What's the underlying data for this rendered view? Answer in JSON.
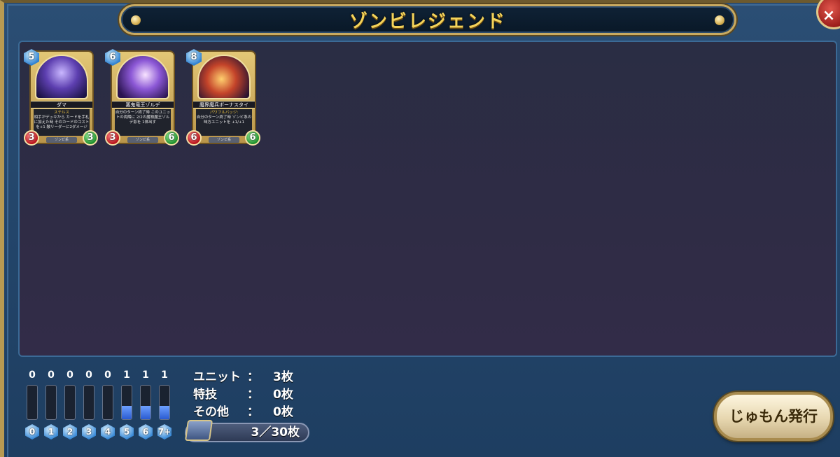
{
  "title": "ゾンビレジェンド",
  "close_label": "×",
  "cards": [
    {
      "cost": "5",
      "attack": "3",
      "hp": "3",
      "name": "ダマ",
      "keyword": "ステルス",
      "text": "相手がデッキから カードを手札に加えた時 そのカードのコストを+1 敵リーダーに2ダメージ",
      "tribe": "ゾンビ系"
    },
    {
      "cost": "6",
      "attack": "3",
      "hp": "6",
      "name": "悪鬼竜王ゾルデ",
      "keyword": "",
      "text": "自分のターン終了時 このユニットの両隣に 2/2の魔物魔王ゾルデ影を 1体出す",
      "tribe": "ゾンビ系"
    },
    {
      "cost": "8",
      "attack": "6",
      "hp": "6",
      "name": "魔界魔兵ボーナスタイ",
      "keyword": "パワフルバッジ:",
      "text": "自分のターン終了時 ゾンビ系の 味方ユニットを +1/+1",
      "tribe": "ゾンビ系"
    }
  ],
  "mana_curve": {
    "counts": [
      "0",
      "0",
      "0",
      "0",
      "0",
      "1",
      "1",
      "1"
    ],
    "fill_fraction": [
      0,
      0,
      0,
      0,
      0,
      0.4,
      0.4,
      0.4
    ],
    "cost_labels": [
      "0",
      "1",
      "2",
      "3",
      "4",
      "5",
      "6",
      "7+"
    ]
  },
  "stats": {
    "unit_label": "ユニット",
    "unit_value": "3枚",
    "skill_label": "特技",
    "skill_value": "0枚",
    "other_label": "その他",
    "other_value": "0枚",
    "colon": "："
  },
  "total_cards": "3／30枚",
  "spell_button_label": "じゅもん発行"
}
